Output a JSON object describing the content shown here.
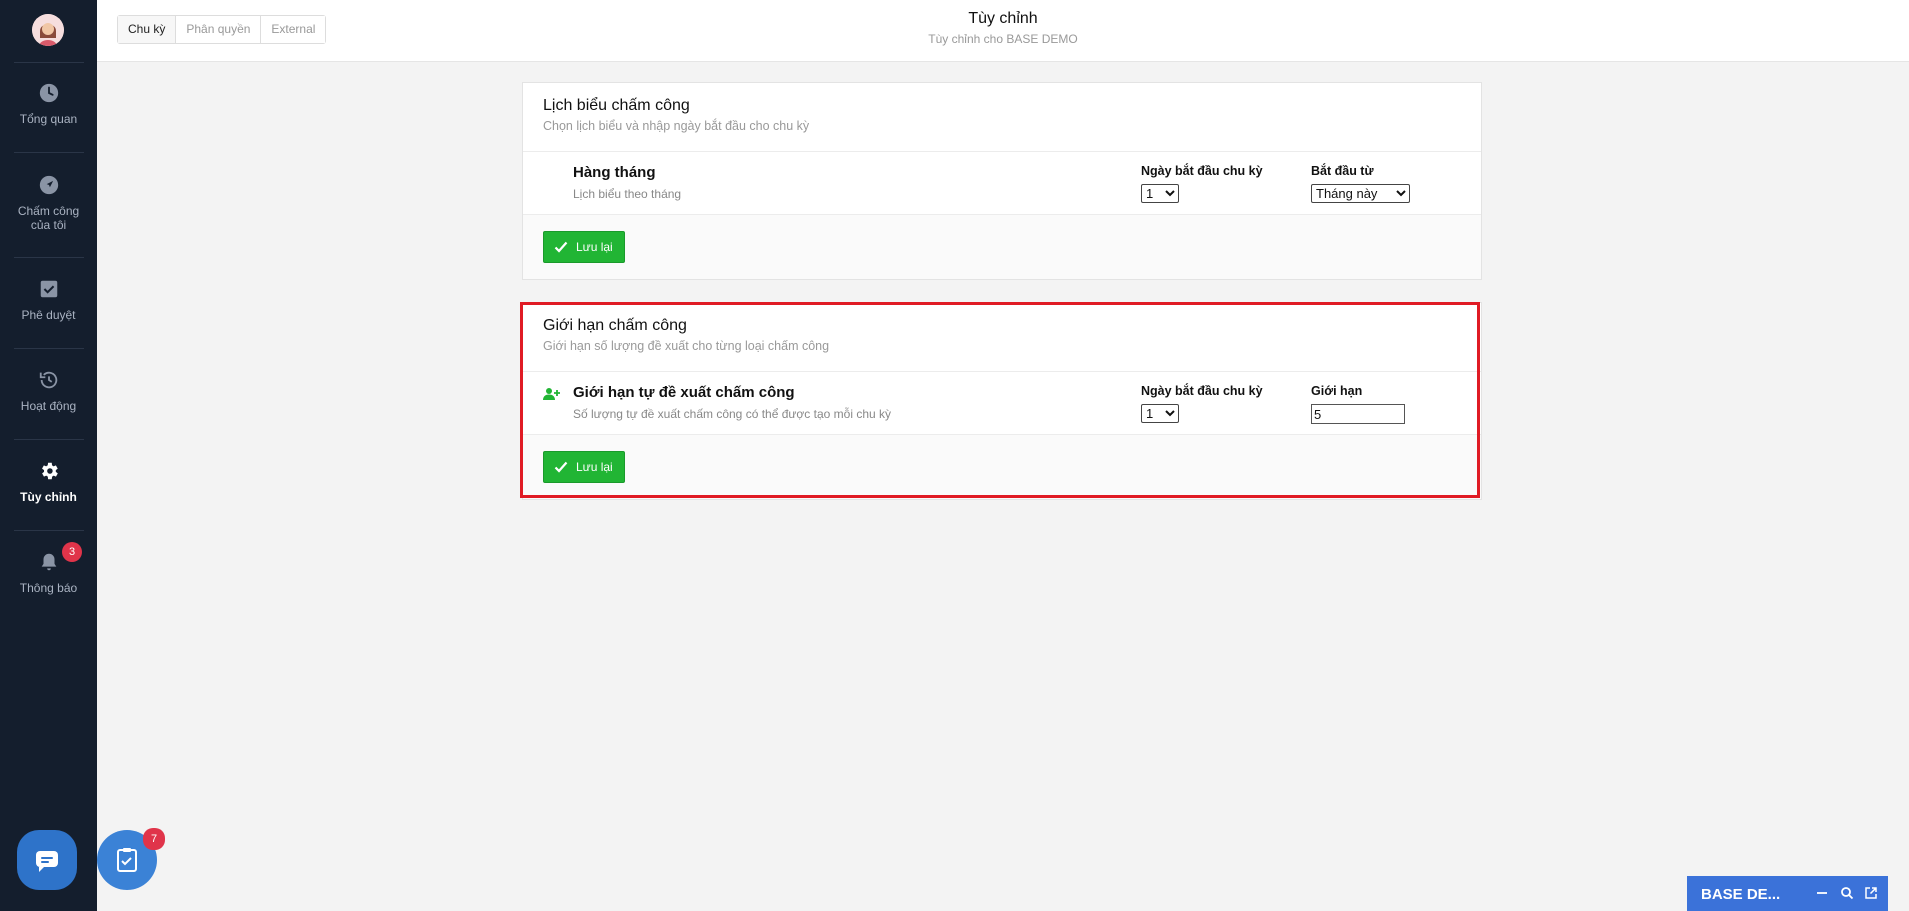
{
  "sidebar": {
    "items": [
      {
        "label": "Tổng quan",
        "icon": "clock-icon"
      },
      {
        "label": "Chấm công của tôi",
        "icon": "navigation-icon"
      },
      {
        "label": "Phê duyệt",
        "icon": "check-square-icon"
      },
      {
        "label": "Hoạt động",
        "icon": "history-icon"
      },
      {
        "label": "Tùy chỉnh",
        "icon": "gear-icon"
      },
      {
        "label": "Thông báo",
        "icon": "bell-icon"
      }
    ],
    "notification_count": "3"
  },
  "floating": {
    "task_count": "7"
  },
  "header": {
    "tabs": [
      {
        "label": "Chu kỳ"
      },
      {
        "label": "Phân quyền"
      },
      {
        "label": "External"
      }
    ],
    "title": "Tùy chỉnh",
    "subtitle": "Tùy chỉnh cho BASE DEMO"
  },
  "card1": {
    "title": "Lịch biểu chấm công",
    "desc": "Chọn lịch biểu và nhập ngày bắt đầu cho chu kỳ",
    "row_name": "Hàng tháng",
    "row_desc": "Lịch biểu theo tháng",
    "field1_label": "Ngày bắt đầu chu kỳ",
    "field1_value": "1",
    "field2_label": "Bắt đầu từ",
    "field2_value": "Tháng này",
    "save_label": "Lưu lại"
  },
  "card2": {
    "title": "Giới hạn chấm công",
    "desc": "Giới hạn số lượng đề xuất cho từng loại chấm công",
    "row_name": "Giới hạn tự đề xuất chấm công",
    "row_desc": "Số lượng tự đề xuất chấm công có thể được tạo mỗi chu kỳ",
    "field1_label": "Ngày bắt đầu chu kỳ",
    "field1_value": "1",
    "field2_label": "Giới hạn",
    "field2_value": "5",
    "save_label": "Lưu lại"
  },
  "widget": {
    "title": "BASE DE..."
  },
  "colors": {
    "sidebar_bg": "#141e2d",
    "save_green": "#21b534",
    "highlight_red": "#e01b24",
    "widget_blue": "#3b72d9"
  }
}
